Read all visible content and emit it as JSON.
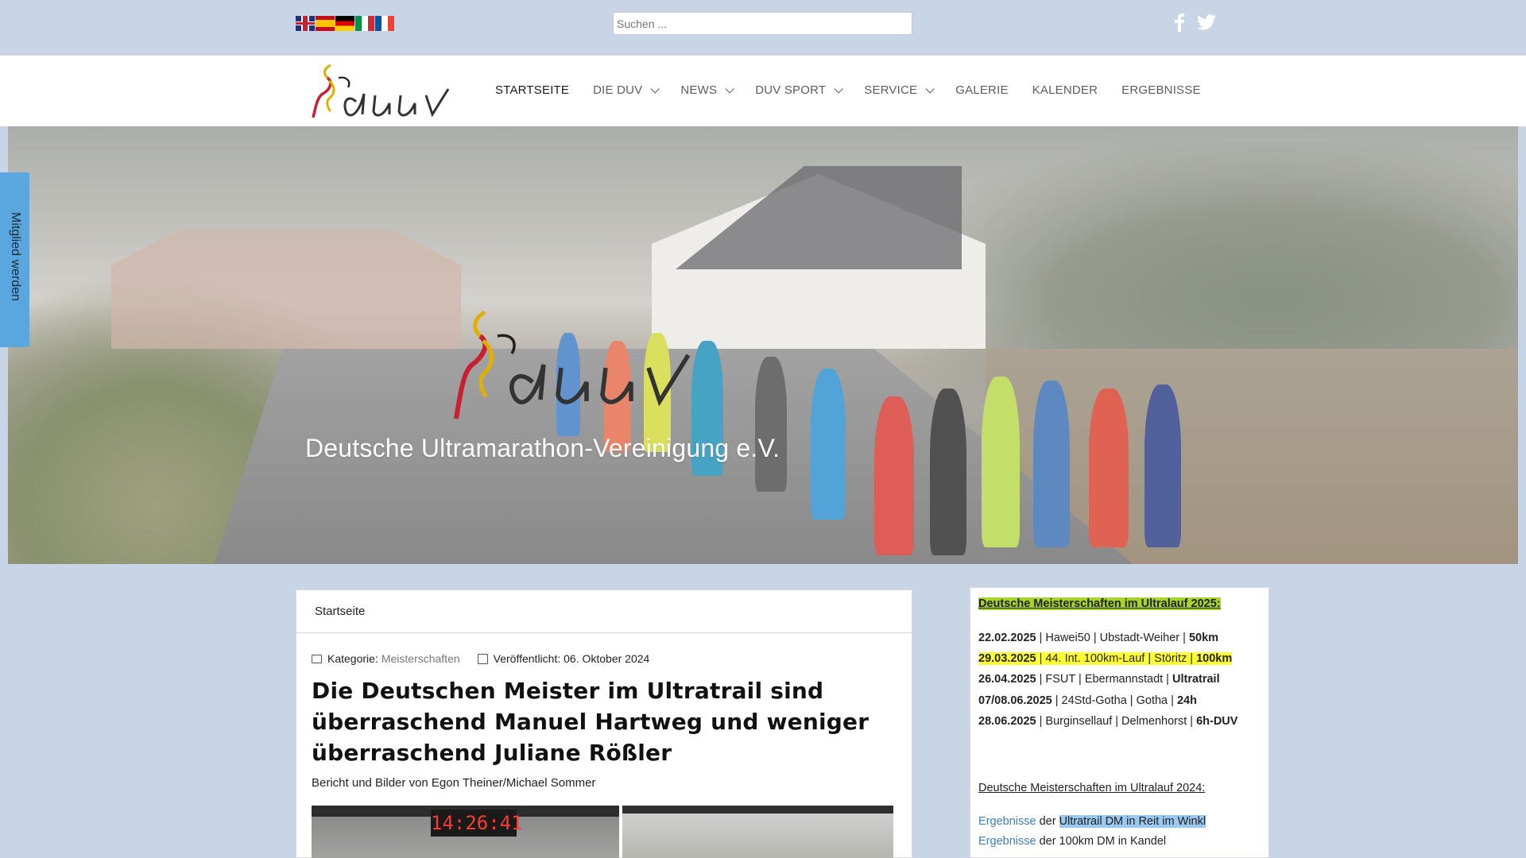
{
  "header": {
    "languages": [
      "English",
      "Español",
      "Deutsch",
      "Italiano",
      "Français"
    ],
    "search_placeholder": "Suchen ...",
    "social": [
      "facebook-icon",
      "twitter-icon"
    ]
  },
  "nav": {
    "items": [
      {
        "label": "STARTSEITE",
        "dropdown": false,
        "active": true
      },
      {
        "label": "DIE DUV",
        "dropdown": true
      },
      {
        "label": "NEWS",
        "dropdown": true
      },
      {
        "label": "DUV SPORT",
        "dropdown": true
      },
      {
        "label": "SERVICE",
        "dropdown": true
      },
      {
        "label": "GALERIE",
        "dropdown": false
      },
      {
        "label": "KALENDER",
        "dropdown": false
      },
      {
        "label": "ERGEBNISSE",
        "dropdown": false
      }
    ]
  },
  "hero": {
    "title": "Deutsche Ultramarathon-Vereinigung e.V."
  },
  "sidetab": {
    "label": "Mitglied werden"
  },
  "article": {
    "breadcrumb": "Startseite",
    "category_label": "Kategorie:",
    "category": "Meisterschaften",
    "published_label": "Veröffentlicht: 06. Oktober 2024",
    "headline": "Die Deutschen Meister im Ultratrail sind überraschend Manuel Hartweg und weniger überraschend Juliane Rößler",
    "byline": "Bericht und Bilder von Egon Theiner/Michael Sommer",
    "photo_clock": "14:26:41"
  },
  "sidebar": {
    "heading2025": "Deutsche Meisterschaften im Ultralauf 2025:",
    "events": [
      {
        "date": "22.02.2025",
        "text": " | Hawei50 | Ubstadt-Weiher | ",
        "dist": "50km",
        "highlight": false
      },
      {
        "date": "29.03.2025",
        "text": " | 44. Int. 100km-Lauf | Störitz  | ",
        "dist": "100km",
        "highlight": true
      },
      {
        "date": "26.04.2025",
        "text": " | FSUT | Ebermannstadt | ",
        "dist": "Ultratrail",
        "highlight": false
      },
      {
        "date": "07/08.06.2025",
        "text": " | 24Std-Gotha | Gotha | ",
        "dist": "24h",
        "highlight": false
      },
      {
        "date": "28.06.2025",
        "text": " | Burginsellauf | Delmenhorst | ",
        "dist": "6h-DUV",
        "highlight": false
      }
    ],
    "heading2024": "Deutsche Meisterschaften im Ultralauf 2024:",
    "results": [
      {
        "link": "Ergebnisse",
        "mid": " der ",
        "rest": "Ultratrail DM in Reit im Winkl",
        "selected": true
      },
      {
        "link": "Ergebnisse",
        "mid": " der 100km DM in Kandel",
        "rest": "",
        "selected": false
      }
    ]
  },
  "colors": {
    "page_bg": "#c7d5e6",
    "tab_blue": "#5aa7df",
    "link_blue": "#3c7fc3",
    "highlight_green": "#a7d42a",
    "highlight_yellow": "#ffff33"
  }
}
